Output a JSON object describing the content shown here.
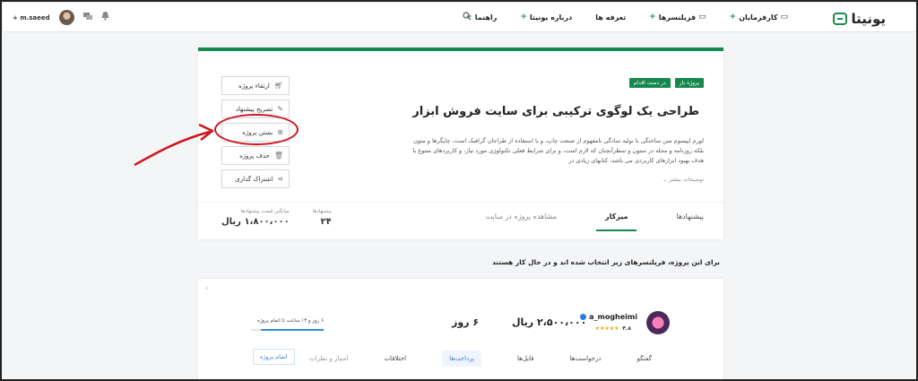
{
  "header": {
    "logo_text": "یونیتا",
    "nav": [
      {
        "label": "کارفرمایان",
        "plus": "+",
        "icon": "briefcase-icon"
      },
      {
        "label": "فریلنسرها",
        "plus": "+",
        "icon": "monitor-icon"
      },
      {
        "label": "تعرفه ها",
        "plus": "",
        "icon": ""
      },
      {
        "label": "درباره یونیتا",
        "plus": "+",
        "icon": ""
      },
      {
        "label": "راهنما",
        "plus": "+",
        "icon": ""
      }
    ],
    "username": "m.saeed",
    "plus_sign": "+"
  },
  "project": {
    "badge_open": "پروژه باز",
    "badge_in_progress": "در دست اقدام",
    "title": "طراحی یک لوگوی ترکیبی برای سایت فروش ابزار",
    "description": "لورم ایپسوم متن ساختگی با تولید سادگی نامفهوم از صنعت چاپ، و با استفاده از طراحان گرافیک است، چاپگرها و متون بلکه روزنامه و مجله در ستون و سطرآنچنان که لازم است، و برای شرایط فعلی تکنولوژی مورد نیاز، و کاربردهای متنوع با هدف بهبود ابزارهای کاربردی می باشد، کتابهای زیادی در",
    "more_label": "توضیحات بیشتر",
    "tabs": [
      "پیشنهادها",
      "میزکار",
      "مشاهده پروژه در سایت"
    ],
    "stats": {
      "proposals_label": "پیشنهادها",
      "proposals_value": "۲۴",
      "avg_label": "میانگین قیمت پیشنهادها",
      "avg_value": "۱،۸۰۰،۰۰۰ ریال"
    },
    "actions": [
      {
        "label": "ارتقاء پروژه",
        "icon": "cart-icon"
      },
      {
        "label": "تصریح پیشنهاد",
        "icon": "pencil-icon"
      },
      {
        "label": "بستن پروژه",
        "icon": "close-circle-icon"
      },
      {
        "label": "حذف پروژه",
        "icon": "trash-icon"
      },
      {
        "label": "اشتراک گذاری",
        "icon": "share-icon"
      }
    ]
  },
  "section_title": "برای این پروژه، فریلنسرهای زیر انتخاب شده اند و در حال کار هستند",
  "freelancer": {
    "name": "a_mogheimi",
    "rating": "۴.۸",
    "stars": 5,
    "price": "۲،۵۰۰،۰۰۰ ریال",
    "days": "۶ روز",
    "remaining": "۶ روز و ۱۳ ساعت تا اتمام پروژه",
    "progress": 0.85,
    "tabs": [
      "گفتگو",
      "درخواست‌ها",
      "فایل‌ها",
      "پرداخت‌ها",
      "اختلافات",
      "امتیاز و نظرات"
    ],
    "finish_button": "اتمام پروژه"
  },
  "colors": {
    "brand": "#16884f",
    "annotation": "#d0121b",
    "accent_blue": "#3b7ed3"
  }
}
